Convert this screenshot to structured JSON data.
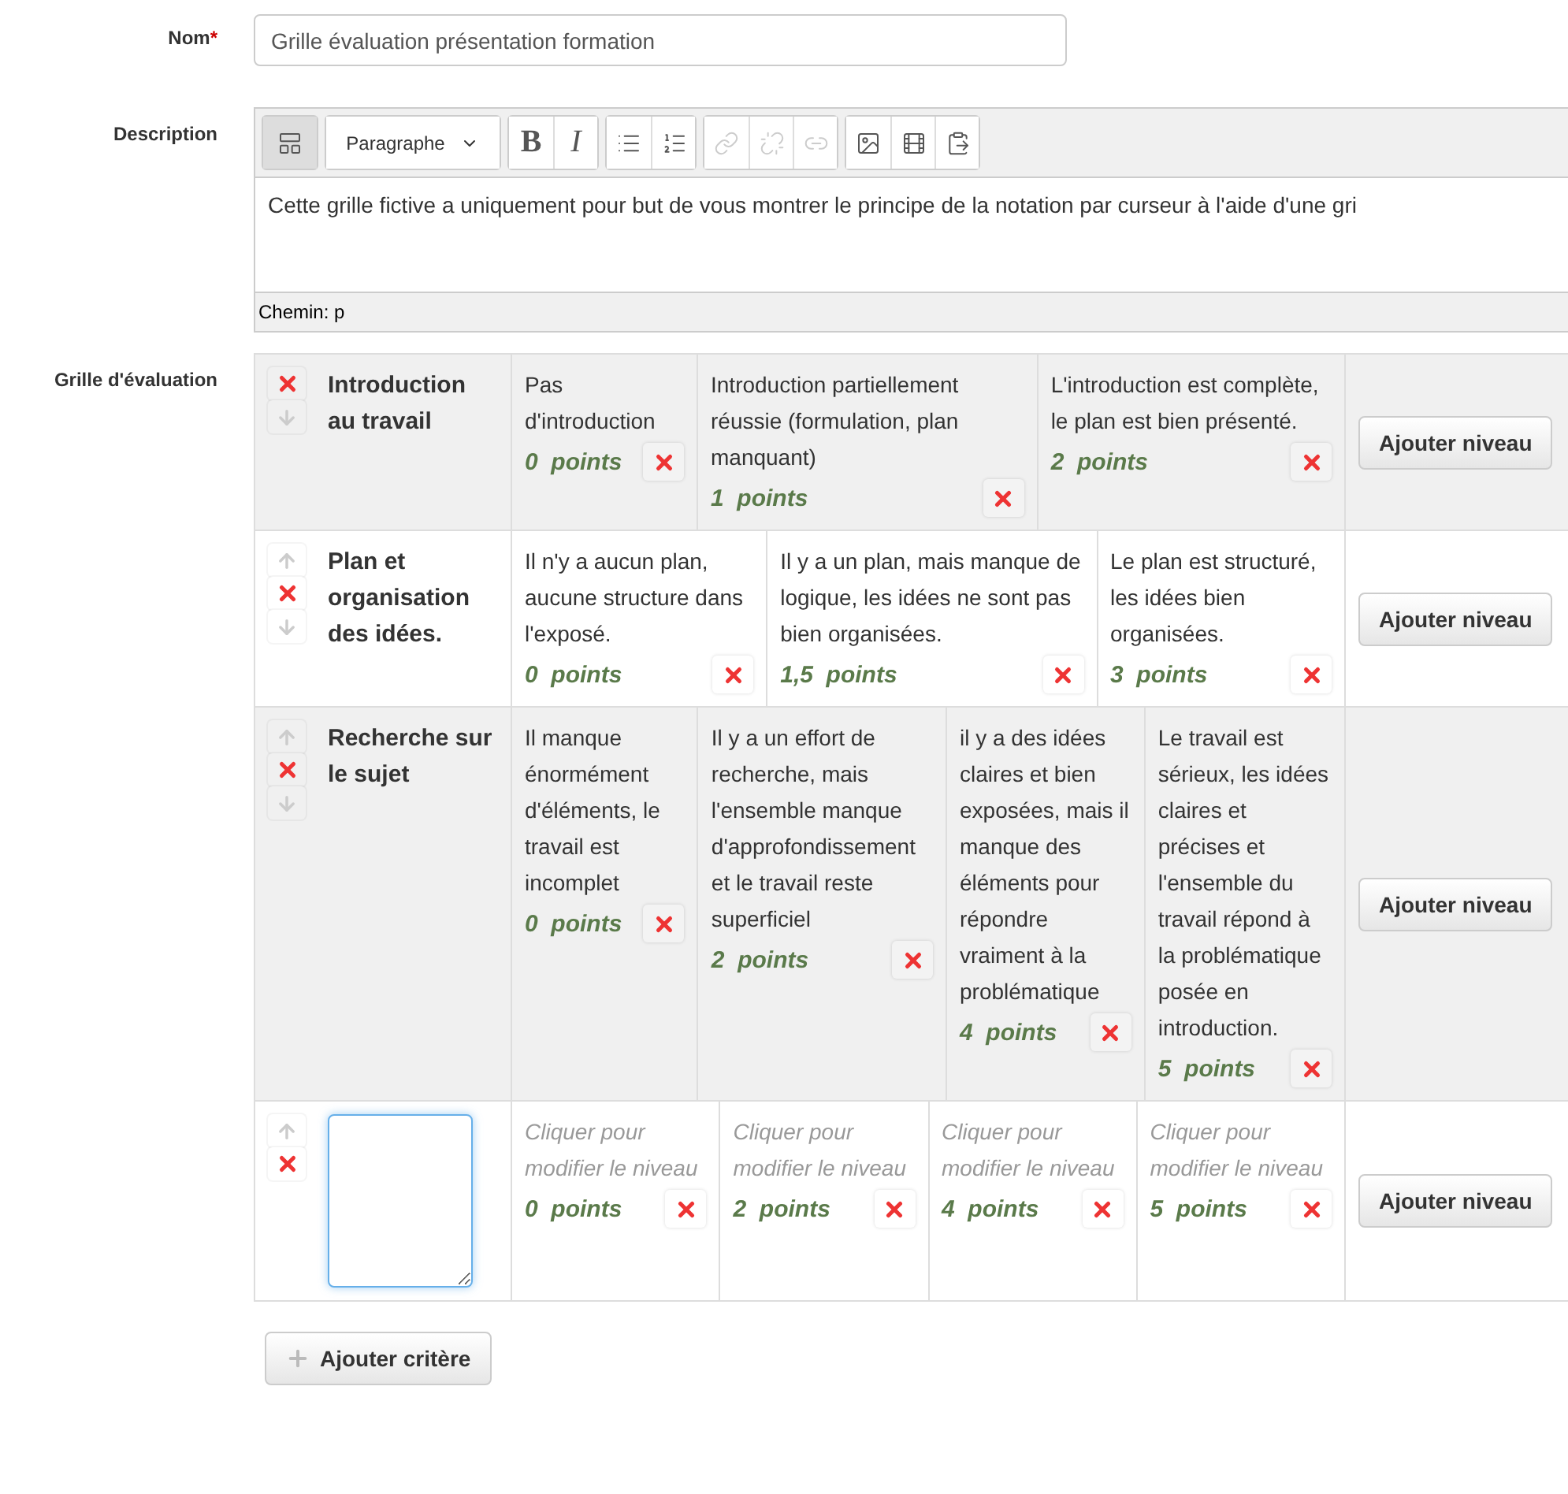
{
  "name_field": {
    "label": "Nom",
    "required_mark": "*",
    "value": "Grille évaluation présentation formation"
  },
  "description": {
    "label": "Description",
    "toolbar": [
      [
        {
          "kind": "toggle",
          "pressed": true,
          "disabled": false
        }
      ],
      [
        {
          "kind": "select",
          "label": "Paragraphe",
          "pressed": false,
          "disabled": false
        }
      ],
      [
        {
          "kind": "bold",
          "label": "B",
          "pressed": false,
          "disabled": false
        },
        {
          "kind": "italic",
          "label": "I",
          "pressed": false,
          "disabled": false
        }
      ],
      [
        {
          "kind": "bullets",
          "pressed": false,
          "disabled": false
        },
        {
          "kind": "numbers",
          "pressed": false,
          "disabled": false
        }
      ],
      [
        {
          "kind": "link",
          "pressed": false,
          "disabled": true
        },
        {
          "kind": "unlink",
          "pressed": false,
          "disabled": true
        },
        {
          "kind": "anchor",
          "pressed": false,
          "disabled": true
        }
      ],
      [
        {
          "kind": "image",
          "pressed": false,
          "disabled": false
        },
        {
          "kind": "media",
          "pressed": false,
          "disabled": false
        },
        {
          "kind": "paste",
          "pressed": false,
          "disabled": false
        }
      ]
    ],
    "text": "Cette grille fictive a uniquement pour but de vous montrer le principe de la notation par curseur à l'aide d'une gri",
    "path": "Chemin: p"
  },
  "rubric": {
    "label": "Grille d'évaluation",
    "criteria": [
      {
        "title": "Introduction au travail",
        "up": false,
        "down": true,
        "editing": false,
        "levels": [
          {
            "definition": "Pas d'introduction",
            "points": "0  points",
            "empty": false
          },
          {
            "definition": "Introduction partiellement réussie (formulation, plan manquant)",
            "points": "1  points",
            "empty": false
          },
          {
            "definition": "L'introduction est complète, le plan est bien présenté.",
            "points": "2  points",
            "empty": false
          }
        ],
        "add_level": "Ajouter niveau"
      },
      {
        "title": "Plan et organisation des idées.",
        "up": true,
        "down": true,
        "editing": false,
        "levels": [
          {
            "definition": "Il n'y a aucun plan, aucune structure dans l'exposé.",
            "points": "0  points",
            "empty": false
          },
          {
            "definition": "Il y a un plan, mais manque de logique, les idées ne sont pas bien organisées.",
            "points": "1,5  points",
            "empty": false
          },
          {
            "definition": "Le plan est structuré, les idées bien organisées.",
            "points": "3  points",
            "empty": false
          }
        ],
        "add_level": "Ajouter niveau"
      },
      {
        "title": "Recherche sur le sujet",
        "up": true,
        "down": true,
        "editing": false,
        "levels": [
          {
            "definition": "Il manque énormément d'éléments, le travail est incomplet",
            "points": "0  points",
            "empty": false
          },
          {
            "definition": "Il y a un effort de recherche, mais l'ensemble manque d'approfondissement et le travail reste superficiel",
            "points": "2  points",
            "empty": false
          },
          {
            "definition": "il y a des idées claires et bien exposées, mais il manque des éléments pour répondre vraiment à la problématique",
            "points": "4  points",
            "empty": false
          },
          {
            "definition": "Le travail est sérieux, les idées claires et précises et l'ensemble du travail répond à la problématique posée en introduction.",
            "points": "5  points",
            "empty": false
          }
        ],
        "add_level": "Ajouter niveau"
      },
      {
        "up": true,
        "down": false,
        "editing": true,
        "levels": [
          {
            "definition": "Cliquer pour modifier le niveau",
            "points": "0  points",
            "empty": true
          },
          {
            "definition": "Cliquer pour modifier le niveau",
            "points": "2  points",
            "empty": true
          },
          {
            "definition": "Cliquer pour modifier le niveau",
            "points": "4  points",
            "empty": true
          },
          {
            "definition": "Cliquer pour modifier le niveau",
            "points": "5  points",
            "empty": true
          }
        ],
        "add_level": "Ajouter niveau"
      }
    ],
    "add_criterion": "Ajouter critère"
  }
}
